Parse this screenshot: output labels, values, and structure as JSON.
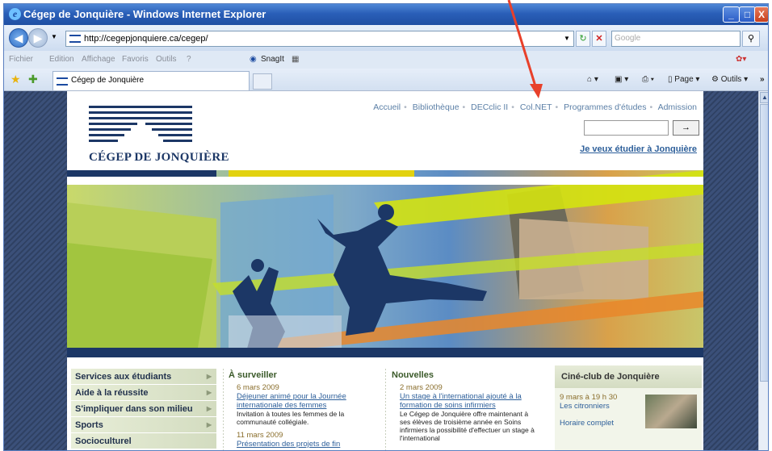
{
  "window": {
    "title": "Cégep de Jonquière - Windows Internet Explorer",
    "minimize": "_",
    "maximize": "□",
    "close": "X"
  },
  "address": {
    "url": "http://cegepjonquiere.ca/cegep/",
    "search_placeholder": "Google"
  },
  "menubar": {
    "items": [
      "Fichier",
      "Edition",
      "Affichage",
      "Favoris",
      "Outils",
      "?"
    ],
    "snagit": "SnagIt"
  },
  "favbar": {
    "tab_title": "Cégep de Jonquière",
    "page_label": "Page",
    "tools_label": "Outils"
  },
  "site": {
    "logo_name": "CÉGEP DE JONQUIÈRE",
    "nav": [
      "Accueil",
      "Bibliothèque",
      "DECclic II",
      "Col.NET",
      "Programmes d'études",
      "Admission"
    ],
    "go_button": "→",
    "want_link": "Je veux étudier à Jonquière",
    "left_menu": [
      "Services aux étudiants",
      "Aide à la réussite",
      "S'impliquer dans son milieu",
      "Sports",
      "Socioculturel"
    ],
    "watch": {
      "heading": "À surveiller",
      "date1": "6 mars 2009",
      "link1": "Déjeuner animé pour la Journée internationale des femmes",
      "text1": "Invitation à toutes les femmes de la communauté collégiale.",
      "date2": "11 mars 2009",
      "link2": "Présentation des projets de fin"
    },
    "news": {
      "heading": "Nouvelles",
      "date1": "2 mars 2009",
      "link1": "Un stage à l'international ajouté à la formation de soins infirmiers",
      "text1": "Le Cégep de Jonquière offre maintenant à ses élèves de troisième année en Soins infirmiers la possibilité d'effectuer un stage à l'international"
    },
    "cine": {
      "heading": "Ciné-club de Jonquière",
      "date": "9 mars à 19 h 30",
      "title": "Les citronniers",
      "schedule": "Horaire complet"
    }
  },
  "colors": {
    "brand_navy": "#1c3766",
    "accent_yellow": "#e2d20f",
    "annotation_arrow": "#e8402a"
  }
}
